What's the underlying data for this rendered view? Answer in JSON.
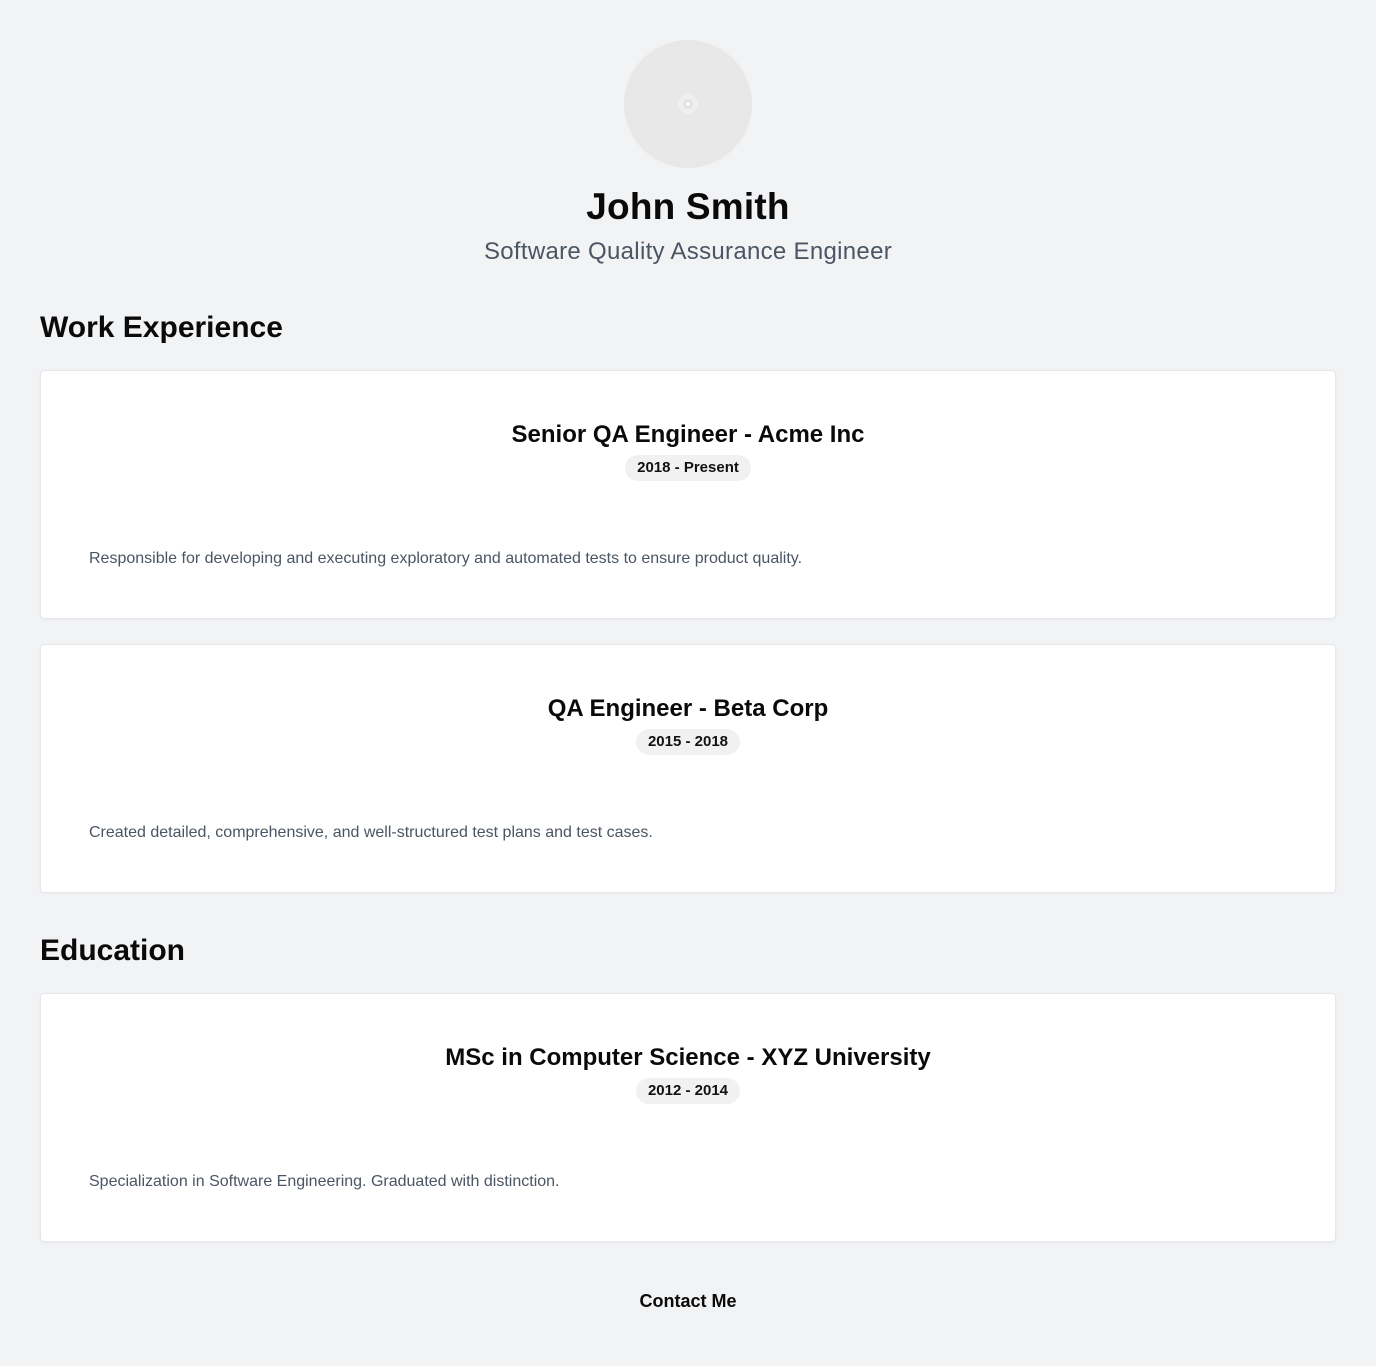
{
  "profile": {
    "name": "John Smith",
    "title": "Software Quality Assurance Engineer",
    "avatar_icon": "user-avatar-placeholder-icon"
  },
  "work": {
    "heading": "Work Experience",
    "items": [
      {
        "role": "Senior QA Engineer - Acme Inc",
        "dates": "2018 - Present",
        "description": "Responsible for developing and executing exploratory and automated tests to ensure product quality."
      },
      {
        "role": "QA Engineer - Beta Corp",
        "dates": "2015 - 2018",
        "description": "Created detailed, comprehensive, and well-structured test plans and test cases."
      }
    ]
  },
  "education": {
    "heading": "Education",
    "items": [
      {
        "degree": "MSc in Computer Science - XYZ University",
        "dates": "2012 - 2014",
        "description": "Specialization in Software Engineering. Graduated with distinction."
      }
    ]
  },
  "contact": {
    "label": "Contact Me"
  },
  "colors": {
    "page_background": "#f2f3f5",
    "card_background": "#ffffff",
    "muted_text": "#4b5563",
    "badge_background": "#f1f1f2"
  }
}
